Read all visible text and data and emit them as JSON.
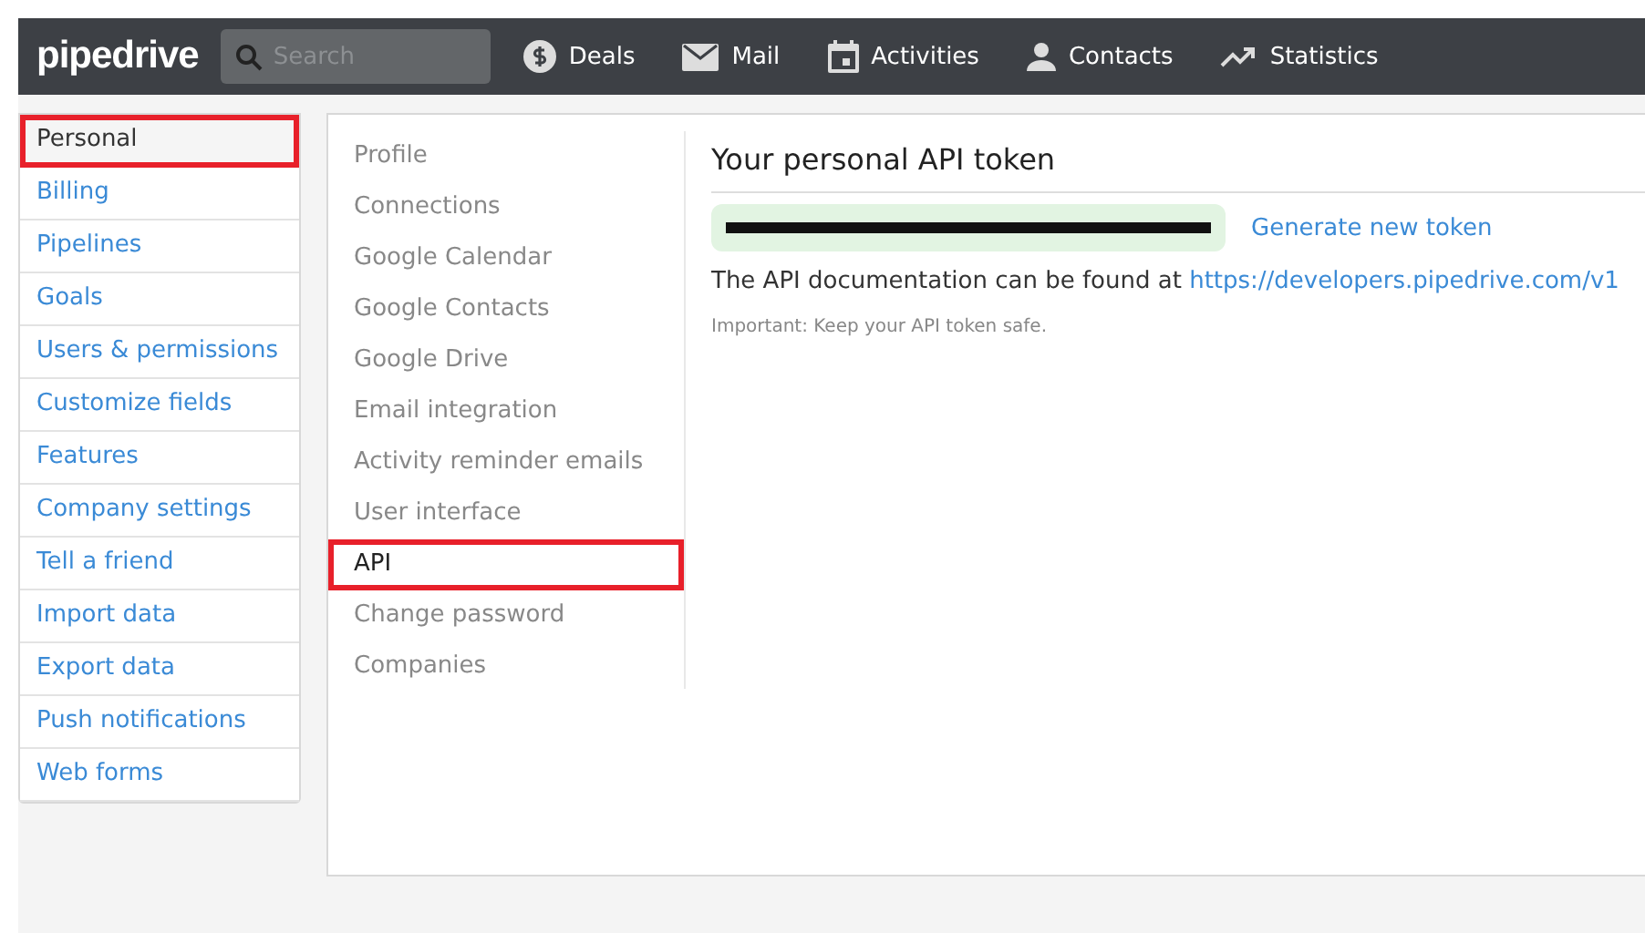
{
  "topbar": {
    "logo": "pipedrive",
    "search": {
      "placeholder": "Search"
    },
    "nav": [
      {
        "kind": "dollar",
        "label": "Deals"
      },
      {
        "kind": "mail",
        "label": "Mail"
      },
      {
        "kind": "calendar",
        "label": "Activities"
      },
      {
        "kind": "person",
        "label": "Contacts"
      },
      {
        "kind": "trend",
        "label": "Statistics"
      }
    ]
  },
  "sidebar": {
    "items": [
      {
        "label": "Personal",
        "selected": true
      },
      {
        "label": "Billing",
        "selected": false
      },
      {
        "label": "Pipelines",
        "selected": false
      },
      {
        "label": "Goals",
        "selected": false
      },
      {
        "label": "Users & permissions",
        "selected": false
      },
      {
        "label": "Customize fields",
        "selected": false
      },
      {
        "label": "Features",
        "selected": false
      },
      {
        "label": "Company settings",
        "selected": false
      },
      {
        "label": "Tell a friend",
        "selected": false
      },
      {
        "label": "Import data",
        "selected": false
      },
      {
        "label": "Export data",
        "selected": false
      },
      {
        "label": "Push notifications",
        "selected": false
      },
      {
        "label": "Web forms",
        "selected": false
      }
    ]
  },
  "submenu": {
    "items": [
      {
        "label": "Profile",
        "selected": false
      },
      {
        "label": "Connections",
        "selected": false
      },
      {
        "label": "Google Calendar",
        "selected": false
      },
      {
        "label": "Google Contacts",
        "selected": false
      },
      {
        "label": "Google Drive",
        "selected": false
      },
      {
        "label": "Email integration",
        "selected": false
      },
      {
        "label": "Activity reminder emails",
        "selected": false
      },
      {
        "label": "User interface",
        "selected": false
      },
      {
        "label": "API",
        "selected": true
      },
      {
        "label": "Change password",
        "selected": false
      },
      {
        "label": "Companies",
        "selected": false
      }
    ]
  },
  "content": {
    "title": "Your personal API token",
    "generate_link": "Generate new token",
    "doc_text": "The API documentation can be found at",
    "doc_link": "https://developers.pipedrive.com/v1",
    "note": "Important: Keep your API token safe."
  }
}
